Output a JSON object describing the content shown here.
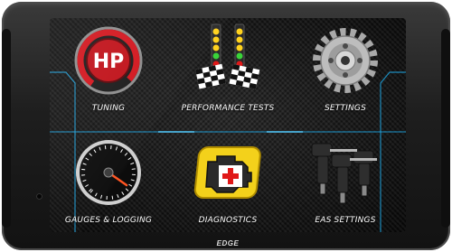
{
  "menu": {
    "items": [
      {
        "label": "TUNING",
        "icon": "hp-gauge-icon"
      },
      {
        "label": "PERFORMANCE TESTS",
        "icon": "drag-tree-icon"
      },
      {
        "label": "SETTINGS",
        "icon": "gear-icon"
      },
      {
        "label": "GAUGES & LOGGING",
        "icon": "gauge-icon"
      },
      {
        "label": "DIAGNOSTICS",
        "icon": "engine-check-icon"
      },
      {
        "label": "EAS SETTINGS",
        "icon": "injector-icon"
      }
    ],
    "hp_text": "HP"
  },
  "device": {
    "brand": "EDGE"
  },
  "colors": {
    "accent_blue": "#1fa9e6",
    "tuning_red": "#d2141c",
    "diag_yellow": "#f3d11b"
  }
}
